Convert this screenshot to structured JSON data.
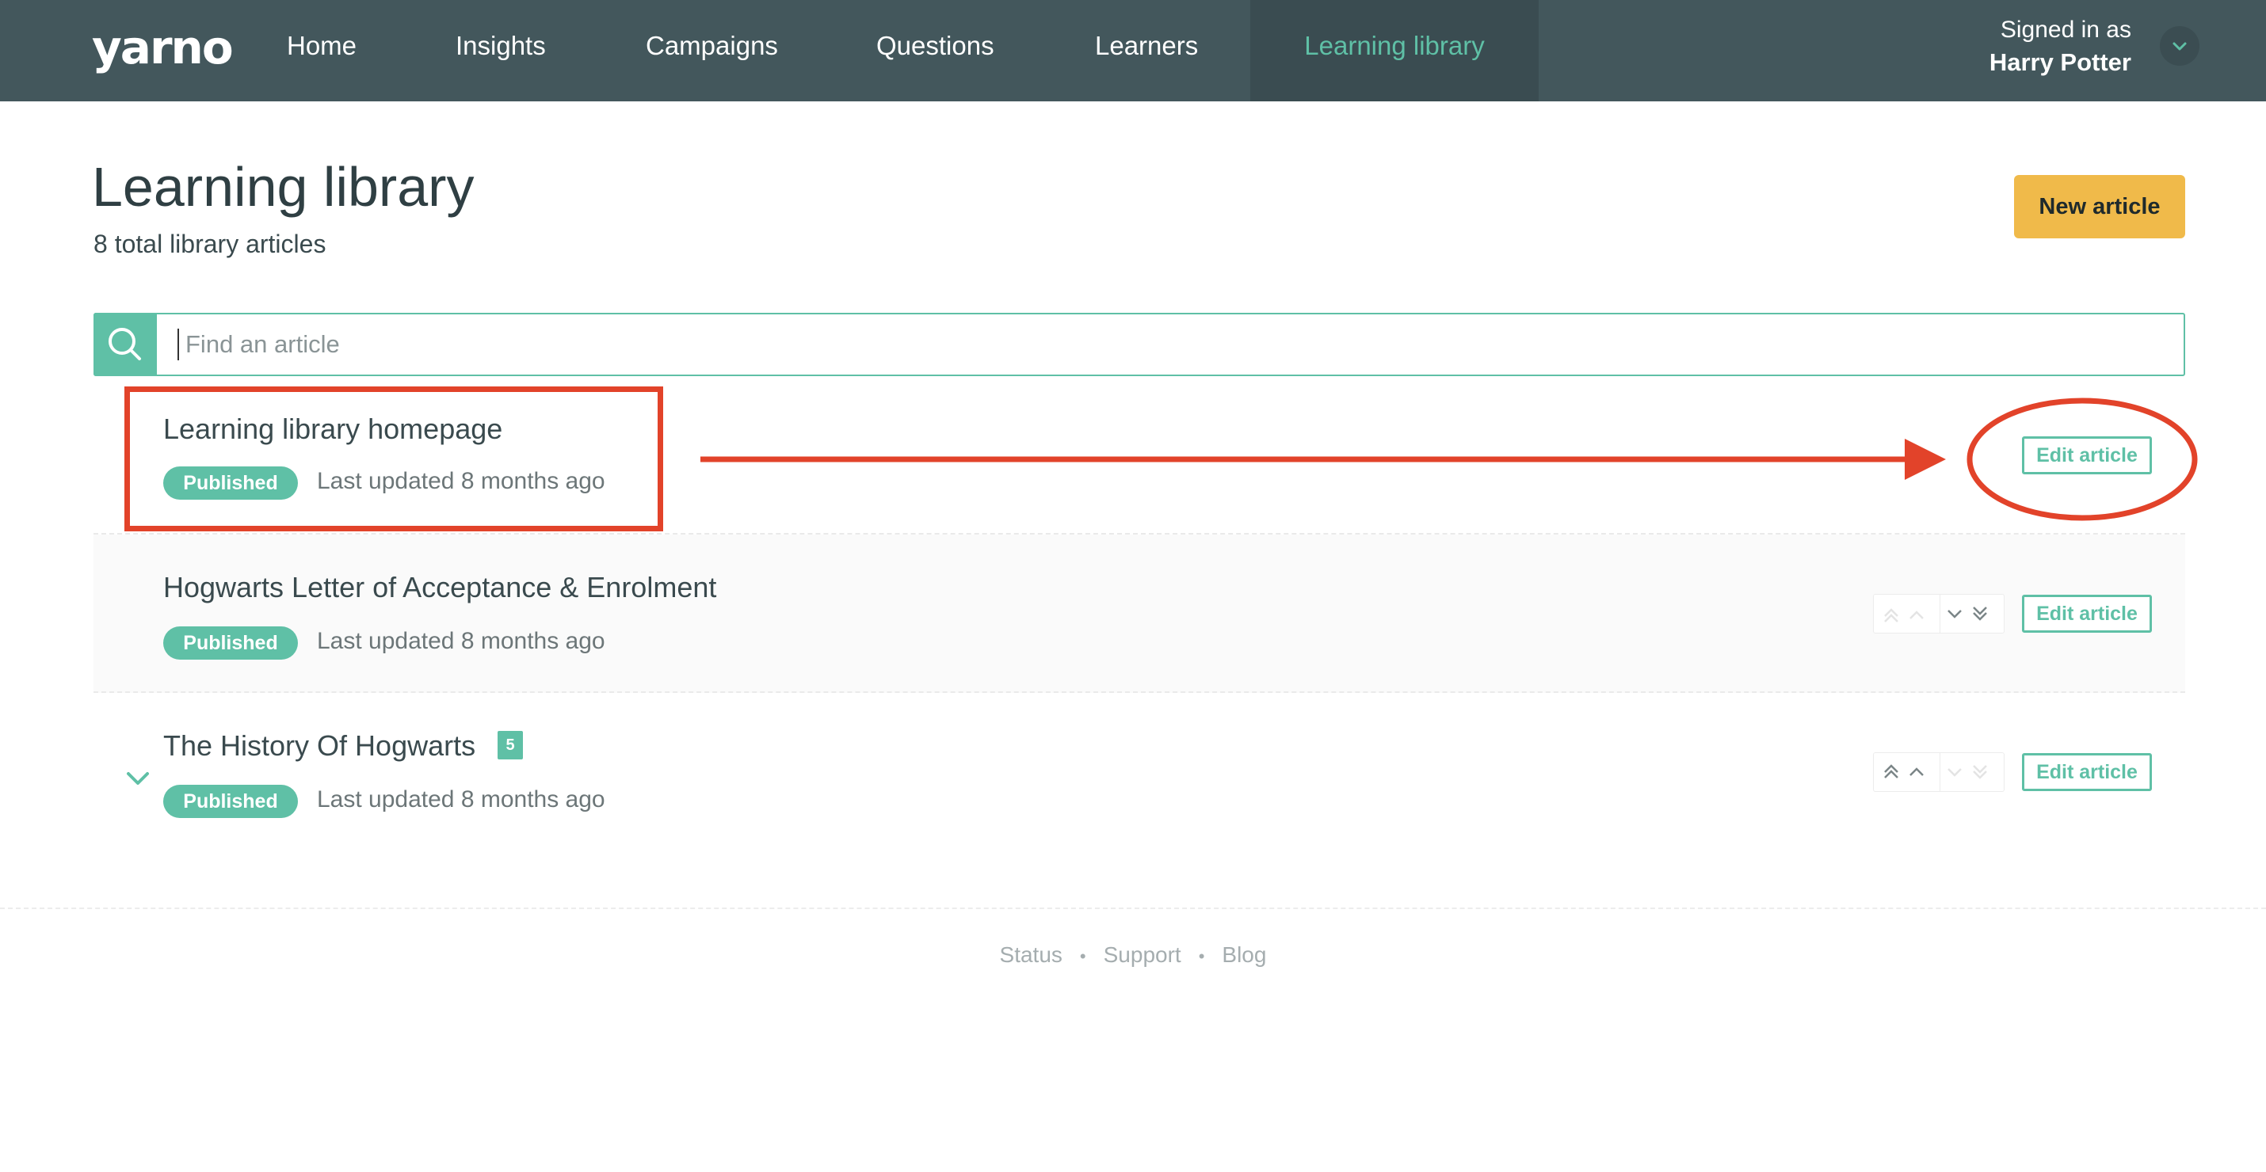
{
  "nav": {
    "logo": "yarno",
    "items": [
      {
        "label": "Home",
        "active": false
      },
      {
        "label": "Insights",
        "active": false
      },
      {
        "label": "Campaigns",
        "active": false
      },
      {
        "label": "Questions",
        "active": false
      },
      {
        "label": "Learners",
        "active": false
      },
      {
        "label": "Learning library",
        "active": true
      }
    ],
    "signed_in_label": "Signed in as",
    "user_name": "Harry Potter",
    "account_icon": "chevron-down-icon"
  },
  "header": {
    "title": "Learning library",
    "subtitle": "8 total library articles",
    "new_article_label": "New article"
  },
  "search": {
    "placeholder": "Find an article",
    "icon": "search-icon"
  },
  "articles": [
    {
      "title": "Learning library homepage",
      "status": "Published",
      "updated": "Last updated 8 months ago",
      "edit_label": "Edit article"
    },
    {
      "title": "Hogwarts Letter of Acceptance & Enrolment",
      "status": "Published",
      "updated": "Last updated 8 months ago",
      "edit_label": "Edit article"
    },
    {
      "title": "The History Of Hogwarts",
      "child_count": "5",
      "status": "Published",
      "updated": "Last updated 8 months ago",
      "edit_label": "Edit article"
    }
  ],
  "footer": {
    "links": [
      "Status",
      "Support",
      "Blog"
    ],
    "separator": "•"
  },
  "colors": {
    "nav_bg": "#43575c",
    "accent": "#5fc0a6",
    "new_button": "#f0ba4a",
    "annotation": "#e2432a"
  }
}
